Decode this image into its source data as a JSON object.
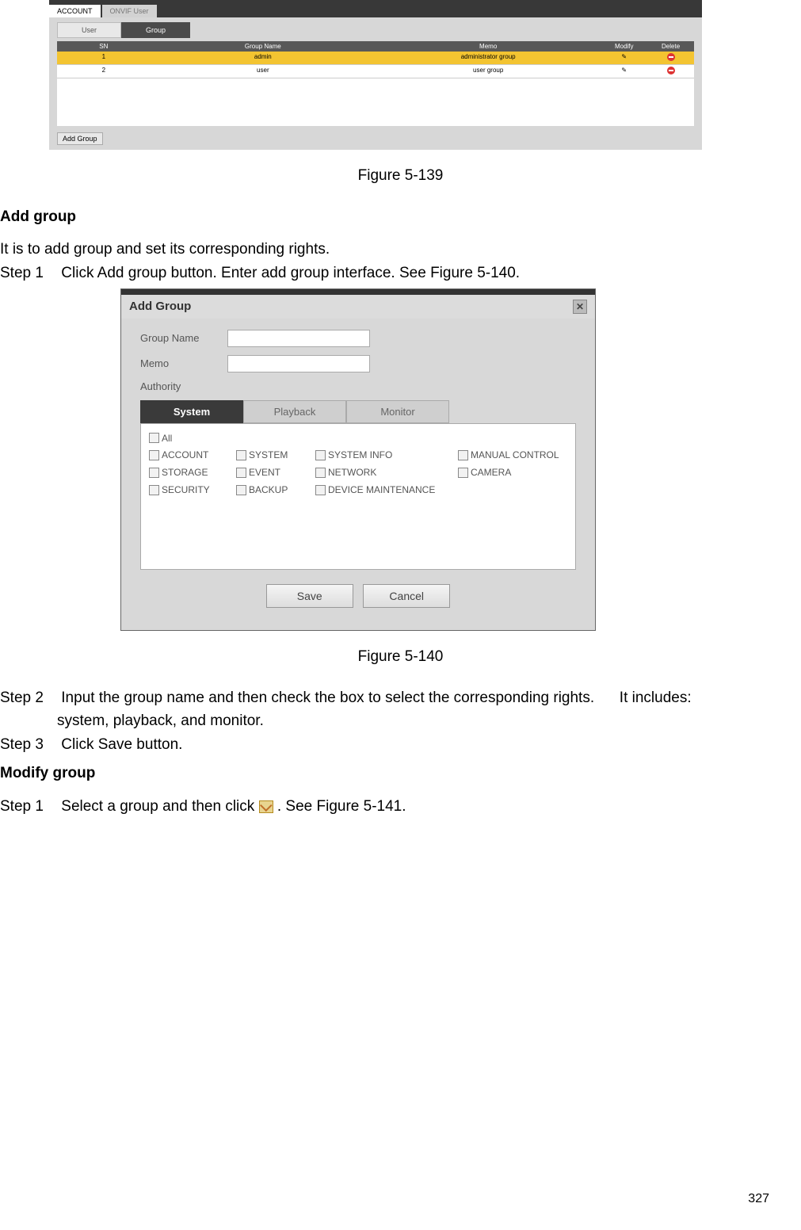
{
  "fig139": {
    "tabs": {
      "account": "ACCOUNT",
      "onvif": "ONVIF User"
    },
    "subtabs": {
      "user": "User",
      "group": "Group"
    },
    "head": {
      "sn": "SN",
      "gn": "Group Name",
      "memo": "Memo",
      "mod": "Modify",
      "del": "Delete"
    },
    "rows": [
      {
        "sn": "1",
        "gn": "admin",
        "memo": "administrator group"
      },
      {
        "sn": "2",
        "gn": "user",
        "memo": "user group"
      }
    ],
    "add_group": "Add Group"
  },
  "caption139": "Figure 5-139",
  "addgroup_h": "Add group",
  "addgroup_p": "It is to add group and set its corresponding rights.",
  "step1": "Step 1",
  "step1_t": "Click Add group button. Enter add group interface. See Figure 5-140.",
  "fig140": {
    "title": "Add Group",
    "group_name": "Group Name",
    "memo": "Memo",
    "authority": "Authority",
    "tabs": {
      "system": "System",
      "playback": "Playback",
      "monitor": "Monitor"
    },
    "all": "All",
    "rights": {
      "r0c0": "ACCOUNT",
      "r0c1": "SYSTEM",
      "r0c2": "SYSTEM INFO",
      "r0c3": "MANUAL CONTROL",
      "r1c0": "STORAGE",
      "r1c1": "EVENT",
      "r1c2": "NETWORK",
      "r1c3": "CAMERA",
      "r2c0": "SECURITY",
      "r2c1": "BACKUP",
      "r2c2": "DEVICE MAINTENANCE"
    },
    "save": "Save",
    "cancel": "Cancel"
  },
  "caption140": "Figure 5-140",
  "step2": "Step 2",
  "step2_t": "Input the group name and then check the box to select the corresponding rights.",
  "step2_tail": "It includes:",
  "step2_line2": "system, playback, and monitor.",
  "step3": "Step 3",
  "step3_t": "Click Save button.",
  "modify_h": "Modify group",
  "mod_step1": "Step 1",
  "mod_step1_a": "Select a group and then click",
  "mod_step1_b": ". See Figure 5-141.",
  "pagenum": "327"
}
